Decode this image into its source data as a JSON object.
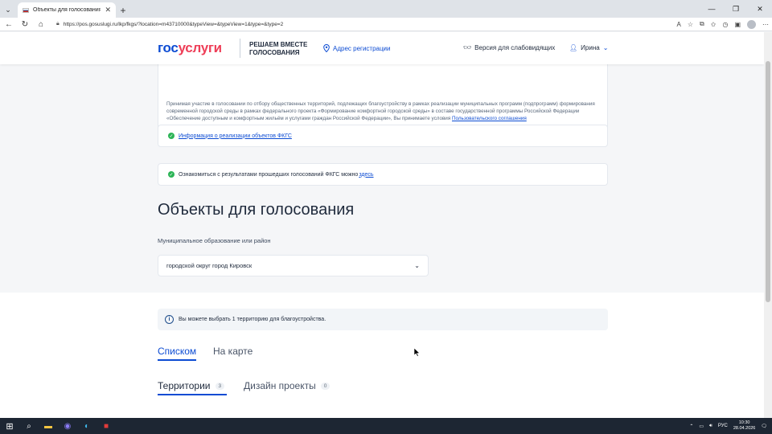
{
  "browser": {
    "tab_title": "Объекты для голосования",
    "tab_close": "✕",
    "url": "https://pos.gosuslugi.ru/lkp/fkgs/?location=m43710000&typeView=&typeView=1&type=&type=2"
  },
  "header": {
    "logo_part1": "гос",
    "logo_part2": "услуги",
    "slogan": "РЕШАЕМ ВМЕСТЕ ГОЛОСОВАНИЯ",
    "reg_address": "Адрес регистрации",
    "accessible_version": "Версия для слабовидящих",
    "user_name": "Ирина"
  },
  "consent": {
    "text": "Принимая участие в голосовании по отбору общественных территорий, подлежащих благоустройству в рамках реализации муниципальных программ (подпрограмм) формирования современной городской среды в рамках федерального проекта «Формирование комфортной городской среды» в составе государственной программы Российской Федерации «Обеспечение доступным и комфортным жильём и услугами граждан Российской Федерации», Вы принимаете условия ",
    "link": "Пользовательского соглашения"
  },
  "info1": {
    "link": "Информация о реализации объектов ФКГС"
  },
  "info2": {
    "text": "Ознакомиться с результатами прошедших голосований ФКГС можно ",
    "link": "здесь"
  },
  "main": {
    "title": "Объекты для голосования",
    "field_label": "Муниципальное образование или район",
    "select_value": "городской округ город Кировск",
    "notice": "Вы можете выбрать 1 территорию для благоустройства.",
    "tab_list": "Списком",
    "tab_map": "На карте",
    "subtab_territories": "Территории",
    "subtab_territories_count": "3",
    "subtab_design": "Дизайн проекты",
    "subtab_design_count": "0"
  },
  "taskbar": {
    "lang": "РУС",
    "time": "10:30",
    "date": "28.04.2026"
  }
}
